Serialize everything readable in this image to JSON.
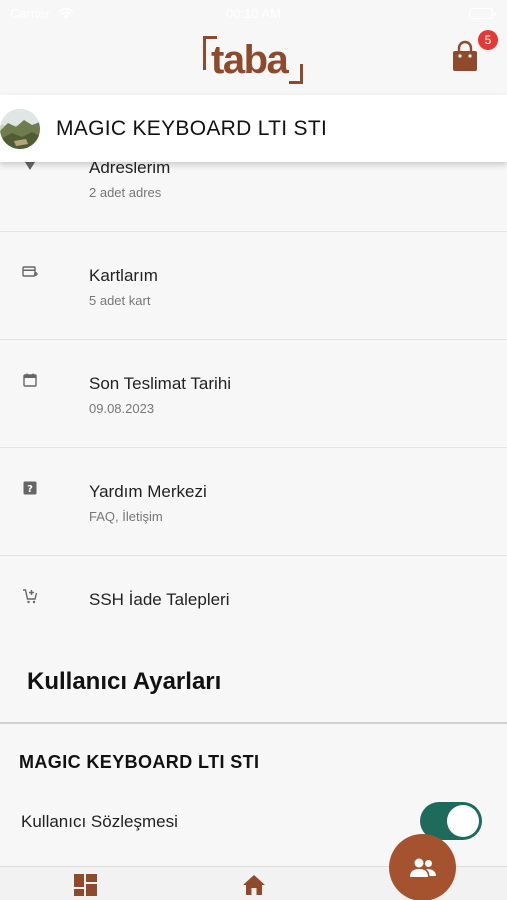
{
  "status_bar": {
    "carrier": "Carrier",
    "time": "00:10 AM"
  },
  "header": {
    "logo_text": "taba",
    "cart_badge": "5",
    "cart_icon": "shopping-bag-icon"
  },
  "profile": {
    "name": "MAGIC KEYBOARD LTI STI"
  },
  "menu": [
    {
      "icon": "location-pin-icon",
      "title": "Adreslerim",
      "subtitle": "2 adet adres"
    },
    {
      "icon": "credit-card-icon",
      "title": "Kartlarım",
      "subtitle": "5 adet kart"
    },
    {
      "icon": "calendar-icon",
      "title": "Son Teslimat Tarihi",
      "subtitle": "09.08.2023"
    },
    {
      "icon": "help-icon",
      "title": "Yardım Merkezi",
      "subtitle": "FAQ, İletişim"
    },
    {
      "icon": "cart-add-icon",
      "title": "SSH İade Talepleri",
      "subtitle": ""
    }
  ],
  "user_settings": {
    "section_title": "Kullanıcı Ayarları",
    "company_name": "MAGIC KEYBOARD LTI STI",
    "agreement_label": "Kullanıcı Sözleşmesi",
    "agreement_enabled": true
  },
  "tab_bar": {
    "items": [
      "dashboard-icon",
      "home-icon",
      "users-icon"
    ]
  },
  "colors": {
    "brand": "#8f4a2c",
    "fab": "#a5532f",
    "toggle_on": "#1e6b5c",
    "badge": "#e53935"
  }
}
